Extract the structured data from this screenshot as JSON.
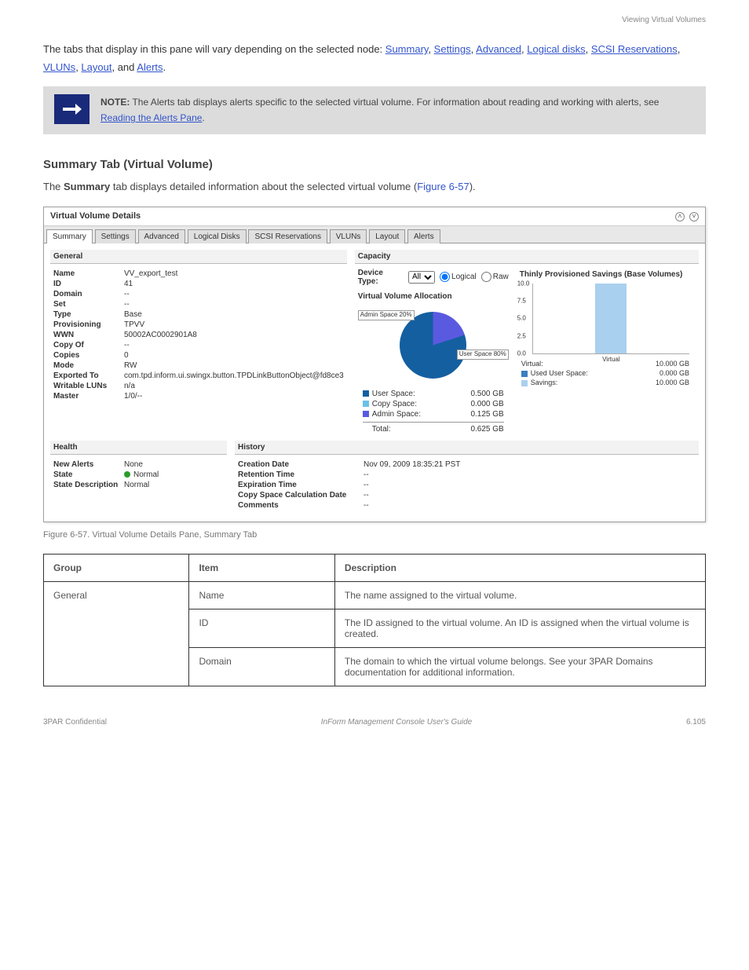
{
  "page": {
    "header_right": "Viewing Virtual Volumes",
    "running_title": "",
    "footer_left": "3PAR Confidential",
    "footer_center": "InForm Management Console User's Guide",
    "footer_right": "6.105",
    "paragraph_lead_prefix": "The tabs that display in this pane will vary depending on the selected node: ",
    "link_summary": "Summary",
    "link_settings": "Settings",
    "link_advanced": "Advanced",
    "link_logical_disks": "Logical disks",
    "link_scsi": "SCSI Reservations",
    "link_vluns": "VLUNs",
    "link_layout": "Layout",
    "paragraph_lead_and": ", and ",
    "link_alerts": "Alerts",
    "paragraph_lead_period": ".",
    "note_bold": "NOTE:",
    "note_text": " The Alerts tab displays alerts specific to the selected virtual volume. For information about reading and working with alerts, see ",
    "note_link": "Reading the Alerts Pane",
    "note_period": ".",
    "summary_heading": "Summary Tab (Virtual Volume)",
    "summary_body_1": "The ",
    "summary_body_bold": "Summary",
    "summary_body_2": " tab displays detailed information about the selected virtual volume (",
    "summary_body_figref": "Figure 6-57",
    "summary_body_3": ").",
    "figure_caption": "Figure 6-57.  Virtual Volume Details Pane, Summary Tab"
  },
  "panel": {
    "title": "Virtual Volume Details",
    "tabs": [
      "Summary",
      "Settings",
      "Advanced",
      "Logical Disks",
      "SCSI Reservations",
      "VLUNs",
      "Layout",
      "Alerts"
    ],
    "general_title": "General",
    "capacity_title": "Capacity",
    "health_title": "Health",
    "history_title": "History",
    "general": {
      "Name": "VV_export_test",
      "ID": "41",
      "Domain": "--",
      "Set": "--",
      "Type": "Base",
      "Provisioning": "TPVV",
      "WWN": "50002AC0002901A8",
      "Copy Of": "--",
      "Copies": "0",
      "Mode": "RW",
      "Exported To": "com.tpd.inform.ui.swingx.button.TPDLinkButtonObject@fd8ce3",
      "Writable LUNs": "n/a",
      "Master": "1/0/--"
    },
    "device_type_label": "Device Type:",
    "device_type_value": "All",
    "radio_logical": "Logical",
    "radio_raw": "Raw",
    "alloc_title": "Virtual Volume Allocation",
    "pie_admin_label": "Admin\nSpace\n20%",
    "pie_user_label": "User\nSpace\n80%",
    "legend": {
      "user_space_label": "User Space:",
      "user_space_val": "0.500 GB",
      "copy_space_label": "Copy Space:",
      "copy_space_val": "0.000 GB",
      "admin_space_label": "Admin Space:",
      "admin_space_val": "0.125 GB",
      "total_label": "Total:",
      "total_val": "0.625 GB"
    },
    "bar_title": "Thinly Provisioned Savings (Base Volumes)",
    "bar_legend": {
      "virtual_label": "Virtual:",
      "virtual_val": "10.000 GB",
      "used_label": "Used User Space:",
      "used_val": "0.000 GB",
      "savings_label": "Savings:",
      "savings_val": "10.000 GB"
    },
    "health": {
      "New Alerts": "None",
      "State": "Normal",
      "State Description": "Normal"
    },
    "history": {
      "Creation Date": "Nov 09, 2009 18:35:21 PST",
      "Retention Time": "--",
      "Expiration Time": "--",
      "Copy Space Calculation Date": "--",
      "Comments": "--"
    }
  },
  "chart_data": [
    {
      "type": "pie",
      "title": "Virtual Volume Allocation",
      "series": [
        {
          "name": "User Space",
          "value": 80,
          "gb": 0.5
        },
        {
          "name": "Admin Space",
          "value": 20,
          "gb": 0.125
        },
        {
          "name": "Copy Space",
          "value": 0,
          "gb": 0.0
        }
      ],
      "total_gb": 0.625
    },
    {
      "type": "bar",
      "title": "Thinly Provisioned Savings (Base Volumes)",
      "categories": [
        "Virtual"
      ],
      "values": [
        10.0
      ],
      "ylabel": "",
      "ylim": [
        0,
        10
      ],
      "yticks": [
        0.0,
        2.5,
        5.0,
        7.5,
        10.0
      ],
      "annotations": {
        "Virtual": 10.0,
        "Used User Space": 0.0,
        "Savings": 10.0
      }
    }
  ],
  "definitions": {
    "header_group": "Group",
    "header_item": "Item",
    "header_desc": "Description",
    "rows": [
      {
        "group": "General",
        "item": "Name",
        "desc": "The name assigned to the virtual volume."
      },
      {
        "group": "",
        "item": "ID",
        "desc": "The ID assigned to the virtual volume. An ID is assigned when the virtual volume is created."
      },
      {
        "group": "",
        "item": "Domain",
        "desc": "The domain to which the virtual volume belongs. See your 3PAR Domains documentation for additional information."
      }
    ]
  }
}
